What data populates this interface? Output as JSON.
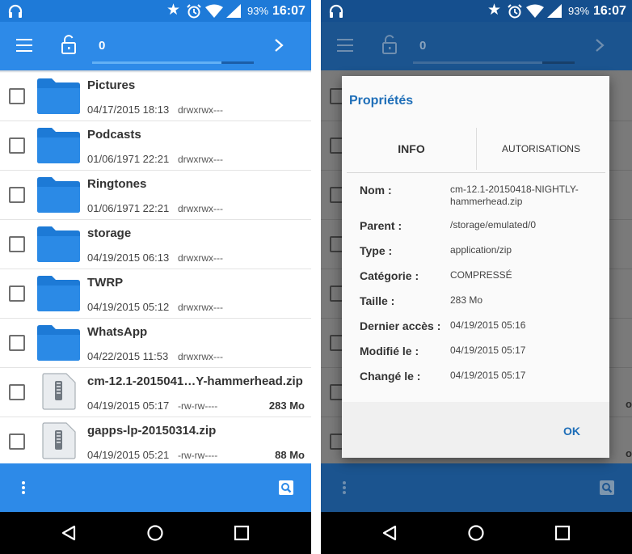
{
  "status_bar": {
    "battery_percent": "93%",
    "time": "16:07"
  },
  "toolbar": {
    "selected_count": "0",
    "progress_fraction": 0.8
  },
  "files": [
    {
      "name": "Pictures",
      "date": "04/17/2015 18:13",
      "permissions": "drwxrwx---",
      "size": "",
      "type": "folder"
    },
    {
      "name": "Podcasts",
      "date": "01/06/1971 22:21",
      "permissions": "drwxrwx---",
      "size": "",
      "type": "folder"
    },
    {
      "name": "Ringtones",
      "date": "01/06/1971 22:21",
      "permissions": "drwxrwx---",
      "size": "",
      "type": "folder"
    },
    {
      "name": "storage",
      "date": "04/19/2015 06:13",
      "permissions": "drwxrwx---",
      "size": "",
      "type": "folder"
    },
    {
      "name": "TWRP",
      "date": "04/19/2015 05:12",
      "permissions": "drwxrwx---",
      "size": "",
      "type": "folder"
    },
    {
      "name": "WhatsApp",
      "date": "04/22/2015 11:53",
      "permissions": "drwxrwx---",
      "size": "",
      "type": "folder"
    },
    {
      "name": "cm-12.1-2015041…Y-hammerhead.zip",
      "date": "04/19/2015 05:17",
      "permissions": "-rw-rw----",
      "size": "283 Mo",
      "type": "zip"
    },
    {
      "name": "gapps-lp-20150314.zip",
      "date": "04/19/2015 05:21",
      "permissions": "-rw-rw----",
      "size": "88 Mo",
      "type": "zip"
    }
  ],
  "dialog": {
    "title": "Propriétés",
    "tab_info": "INFO",
    "tab_permissions": "AUTORISATIONS",
    "ok_label": "OK",
    "properties": [
      {
        "key": "Nom :",
        "value": "cm-12.1-20150418-NIGHTLY-hammerhead.zip"
      },
      {
        "key": "Parent :",
        "value": "/storage/emulated/0"
      },
      {
        "key": "Type :",
        "value": "application/zip"
      },
      {
        "key": "Catégorie :",
        "value": "COMPRESSÉ"
      },
      {
        "key": "Taille :",
        "value": "283 Mo"
      },
      {
        "key": "Dernier accès :",
        "value": "04/19/2015 05:16"
      },
      {
        "key": "Modifié le :",
        "value": "04/19/2015 05:17"
      },
      {
        "key": "Changé le :",
        "value": "04/19/2015 05:17"
      }
    ]
  },
  "background_fragments": {
    "row7_size_fragment": "o",
    "row8_size_fragment": "o"
  },
  "icons": {
    "status": [
      "headphones-icon",
      "star-icon",
      "alarm-icon",
      "wifi-icon",
      "signal-icon"
    ],
    "toolbar": [
      "menu-icon",
      "lock-icon",
      "chevron-right-icon"
    ],
    "bottom": [
      "overflow-menu-icon",
      "search-icon"
    ],
    "nav": [
      "back-icon",
      "home-icon",
      "recents-icon"
    ],
    "files": [
      "folder-icon",
      "zip-file-icon"
    ]
  },
  "colors": {
    "accent": "#2d8ae8",
    "status_bar": "#1e7ad8",
    "dialog_title": "#1e6eb8"
  }
}
